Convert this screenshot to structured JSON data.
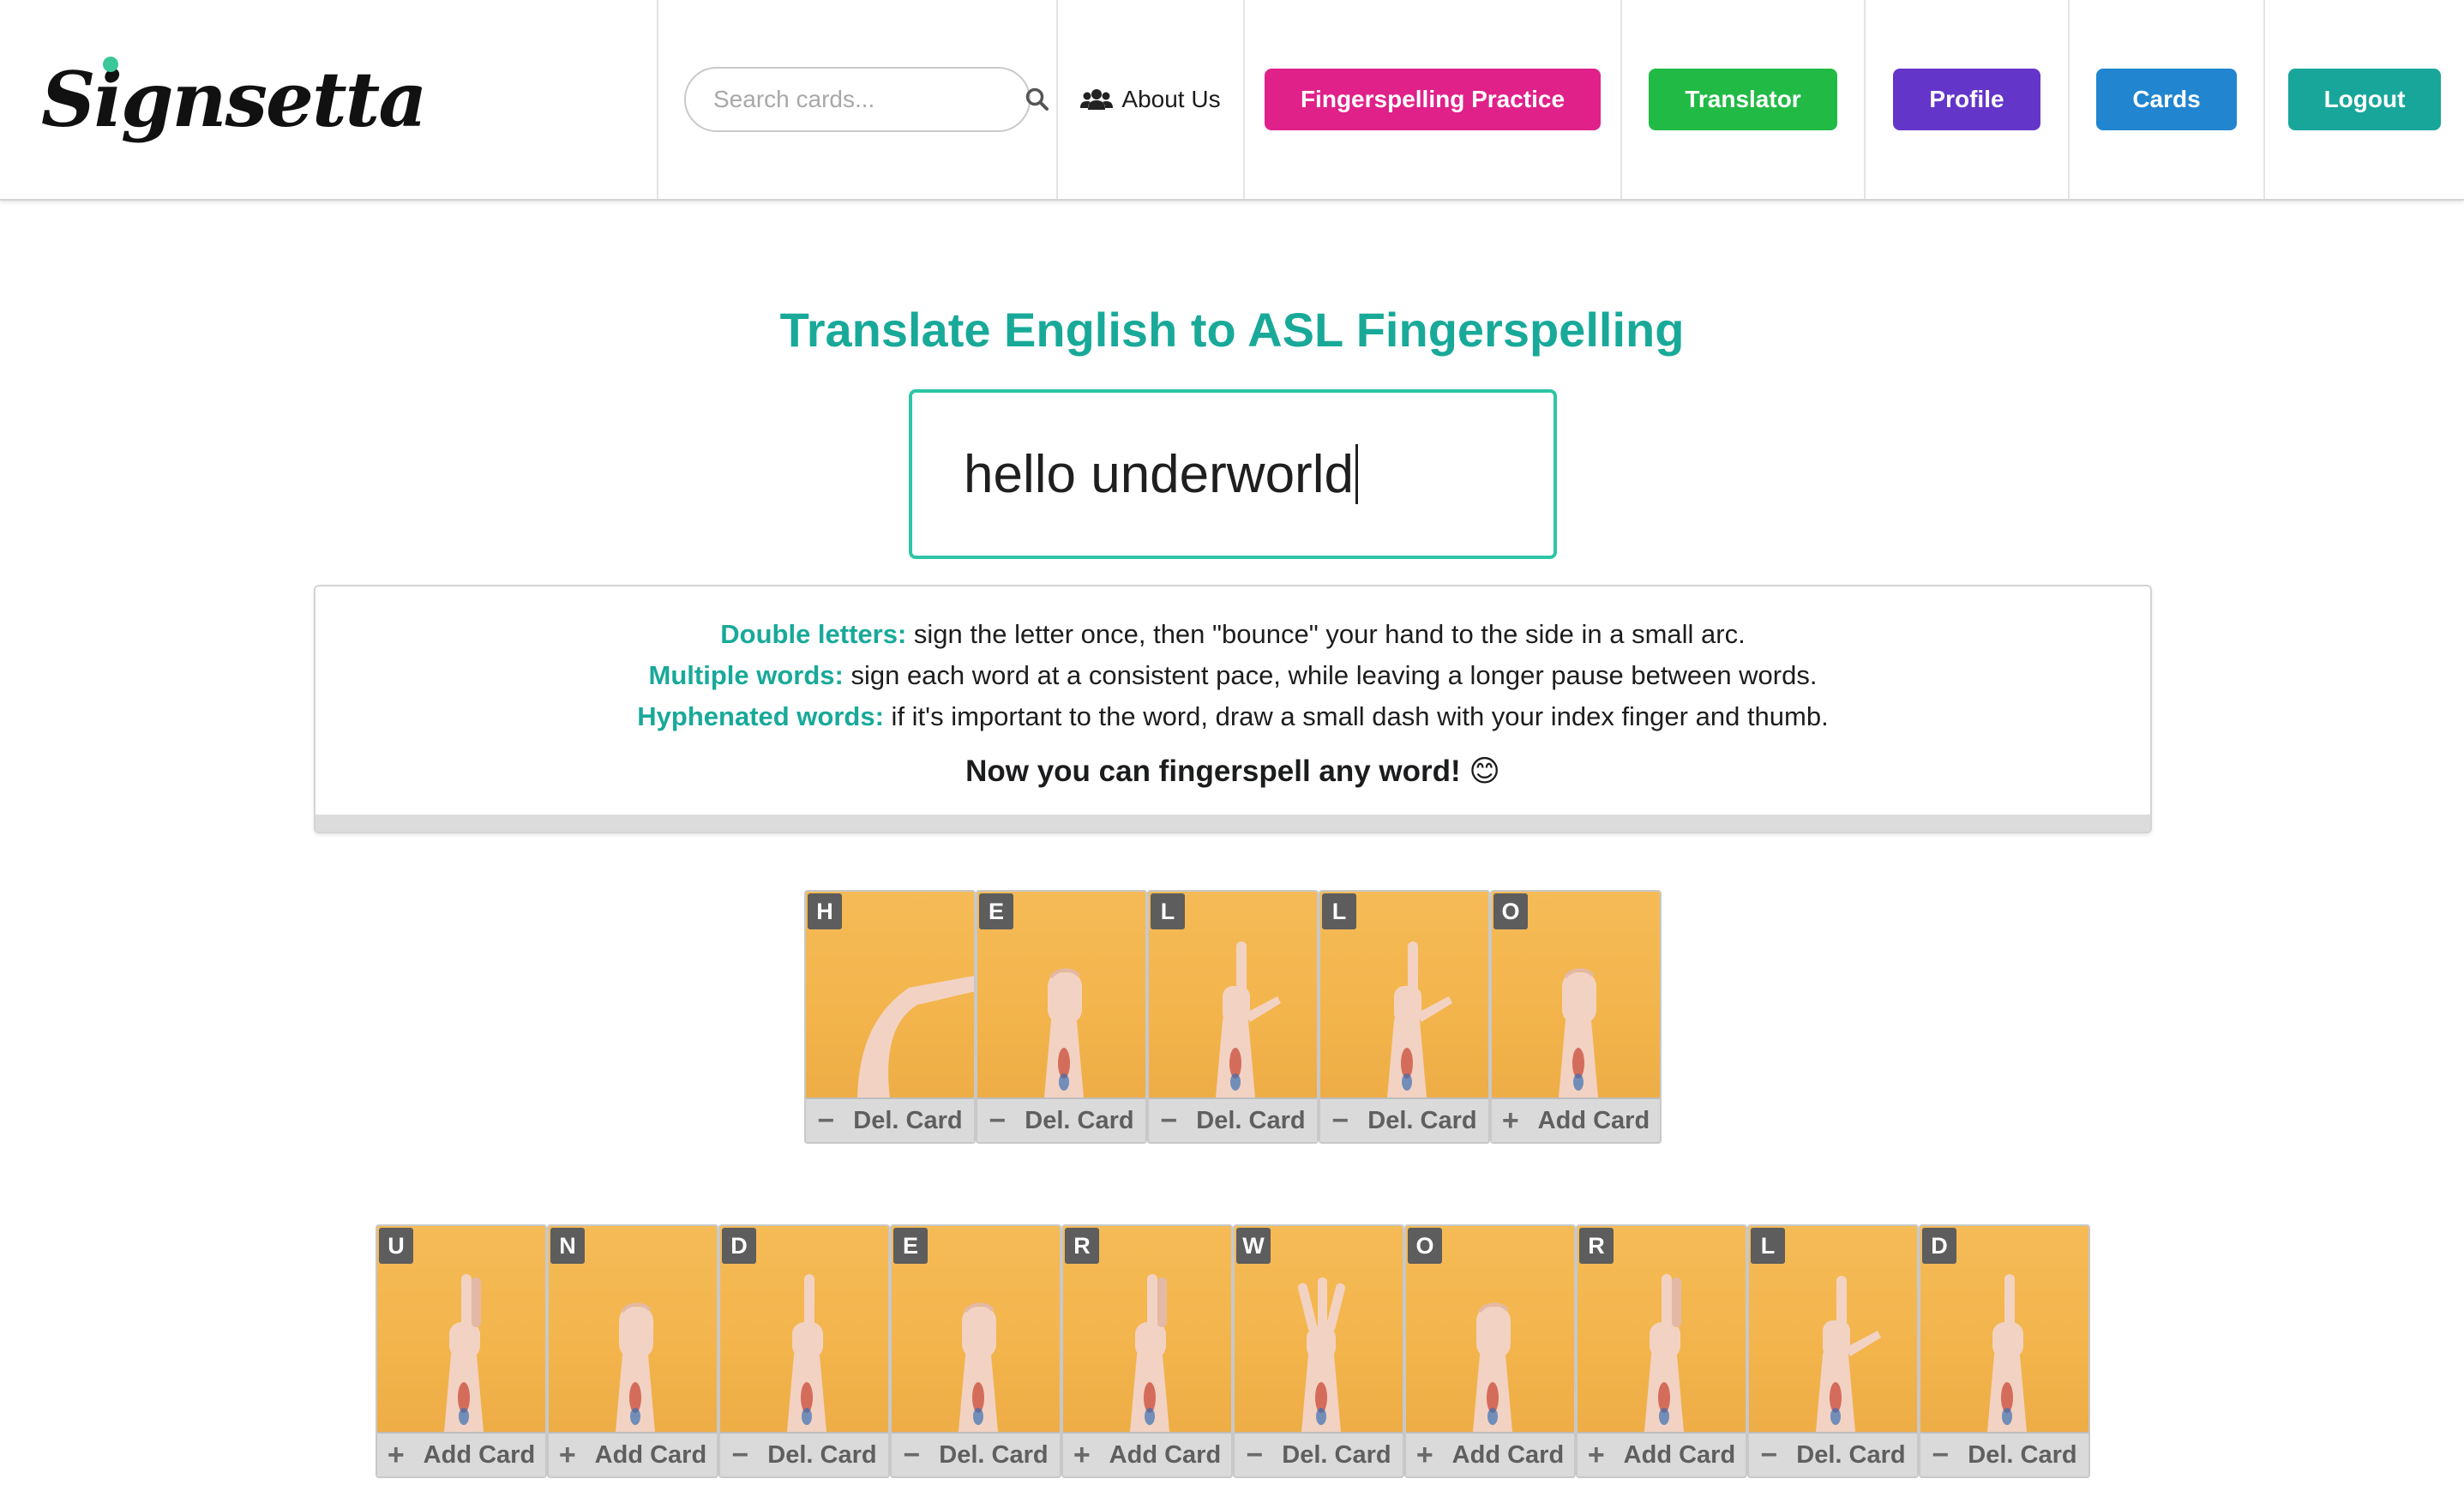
{
  "brand": {
    "logo_text": "Signsetta",
    "accent_dot_color": "#3cc79a"
  },
  "nav": {
    "search_placeholder": "Search cards...",
    "about_label": "About Us",
    "buttons": [
      {
        "label": "Fingerspelling Practice",
        "color": "#e0218a"
      },
      {
        "label": "Translator",
        "color": "#21ba45"
      },
      {
        "label": "Profile",
        "color": "#6435c9"
      },
      {
        "label": "Cards",
        "color": "#2185d0"
      },
      {
        "label": "Logout",
        "color": "#19a69a"
      }
    ]
  },
  "main": {
    "title": "Translate English to ASL Fingerspelling",
    "input_value": "hello underworld",
    "tips": [
      {
        "label": "Double letters:",
        "text": " sign the letter once, then \"bounce\" your hand to the side in a small arc."
      },
      {
        "label": "Multiple words:",
        "text": " sign each word at a consistent pace, while leaving a longer pause between words."
      },
      {
        "label": "Hyphenated words:",
        "text": " if it's important to the word, draw a small dash with your index finger and thumb."
      }
    ],
    "closing": "Now you can fingerspell any word! 😊"
  },
  "words": [
    {
      "cards": [
        {
          "letter": "H",
          "action": "Del. Card",
          "icon": "minus-icon"
        },
        {
          "letter": "E",
          "action": "Del. Card",
          "icon": "minus-icon"
        },
        {
          "letter": "L",
          "action": "Del. Card",
          "icon": "minus-icon"
        },
        {
          "letter": "L",
          "action": "Del. Card",
          "icon": "minus-icon"
        },
        {
          "letter": "O",
          "action": "Add Card",
          "icon": "plus-icon"
        }
      ]
    },
    {
      "cards": [
        {
          "letter": "U",
          "action": "Add Card",
          "icon": "plus-icon"
        },
        {
          "letter": "N",
          "action": "Add Card",
          "icon": "plus-icon"
        },
        {
          "letter": "D",
          "action": "Del. Card",
          "icon": "minus-icon"
        },
        {
          "letter": "E",
          "action": "Del. Card",
          "icon": "minus-icon"
        },
        {
          "letter": "R",
          "action": "Add Card",
          "icon": "plus-icon"
        },
        {
          "letter": "W",
          "action": "Del. Card",
          "icon": "minus-icon"
        },
        {
          "letter": "O",
          "action": "Add Card",
          "icon": "plus-icon"
        },
        {
          "letter": "R",
          "action": "Add Card",
          "icon": "plus-icon"
        },
        {
          "letter": "L",
          "action": "Del. Card",
          "icon": "minus-icon"
        },
        {
          "letter": "D",
          "action": "Del. Card",
          "icon": "minus-icon"
        }
      ]
    }
  ]
}
